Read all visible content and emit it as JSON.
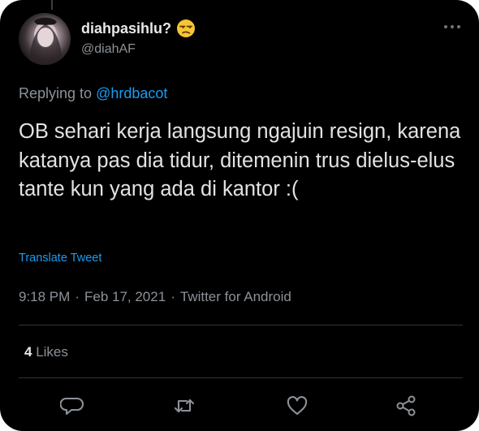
{
  "tweet": {
    "author": {
      "display_name": "diahpasihlu?",
      "display_emoji": "unamused-face-emoji",
      "handle": "@diahAF",
      "avatar": "user-avatar-photo"
    },
    "reply": {
      "prefix": "Replying to",
      "mention": "@hrdbacot"
    },
    "text": "OB sehari kerja langsung ngajuin resign, karena katanya pas dia tidur, ditemenin trus dielus-elus tante kun yang ada di kantor :(",
    "translate_label": "Translate Tweet",
    "time": "9:18 PM",
    "date": "Feb 17, 2021",
    "source": "Twitter for Android",
    "separator": "·",
    "likes": {
      "count": "4",
      "label": "Likes"
    }
  },
  "icons": {
    "more": "more-icon",
    "reply": "reply-icon",
    "retweet": "retweet-icon",
    "like": "heart-icon",
    "share": "share-icon"
  },
  "colors": {
    "background": "#000000",
    "text": "#e2e2e2",
    "secondary_text": "#8b9298",
    "accent": "#1d9bf0",
    "divider": "#2f3336"
  }
}
